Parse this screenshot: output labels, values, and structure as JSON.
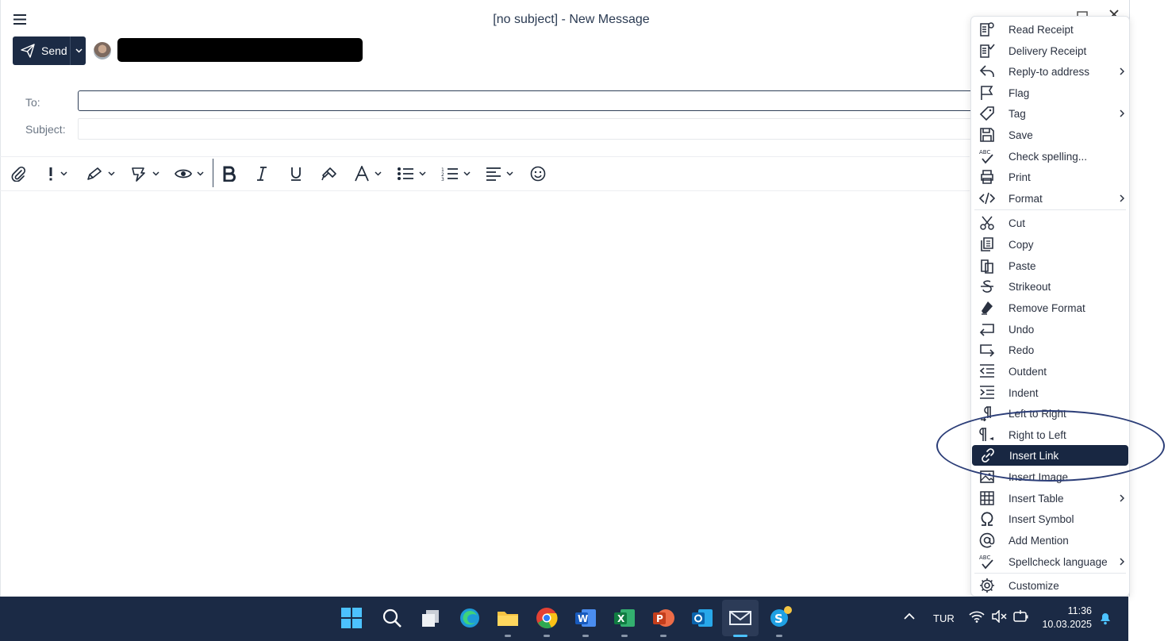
{
  "window": {
    "title": "[no subject] - New Message"
  },
  "compose": {
    "send_label": "Send",
    "to_label": "To:",
    "subject_label": "Subject:",
    "to_value": "",
    "subject_value": ""
  },
  "toolbar": {
    "icons": [
      "attach-icon",
      "importance-icon",
      "signature-icon",
      "quick-parts-icon",
      "view-icon",
      "bold-icon",
      "italic-icon",
      "underline-icon",
      "format-painter-icon",
      "font-color-icon",
      "bullet-list-icon",
      "numbered-list-icon",
      "align-icon",
      "emoji-icon"
    ]
  },
  "context_menu": {
    "items": [
      {
        "label": "Read Receipt"
      },
      {
        "label": "Delivery Receipt"
      },
      {
        "label": "Reply-to address",
        "submenu": true
      },
      {
        "label": "Flag"
      },
      {
        "label": "Tag",
        "submenu": true
      },
      {
        "label": "Save"
      },
      {
        "label": "Check spelling..."
      },
      {
        "label": "Print"
      },
      {
        "label": "Format",
        "submenu": true
      },
      {
        "label": "Cut"
      },
      {
        "label": "Copy"
      },
      {
        "label": "Paste"
      },
      {
        "label": "Strikeout"
      },
      {
        "label": "Remove Format"
      },
      {
        "label": "Undo"
      },
      {
        "label": "Redo"
      },
      {
        "label": "Outdent"
      },
      {
        "label": "Indent"
      },
      {
        "label": "Left to Right"
      },
      {
        "label": "Right to Left"
      },
      {
        "label": "Insert Link",
        "highlighted": true
      },
      {
        "label": "Insert Image"
      },
      {
        "label": "Insert Table",
        "submenu": true
      },
      {
        "label": "Insert Symbol"
      },
      {
        "label": "Add Mention"
      },
      {
        "label": "Spellcheck language",
        "submenu": true
      },
      {
        "label": "Customize"
      }
    ]
  },
  "taskbar": {
    "language": "TUR",
    "time": "11:36",
    "date": "10.03.2025"
  },
  "colors": {
    "accent": "#1c2b45",
    "highlight": "#182742",
    "annotation": "#2c3e78",
    "taskbar": "#1b2a45"
  }
}
